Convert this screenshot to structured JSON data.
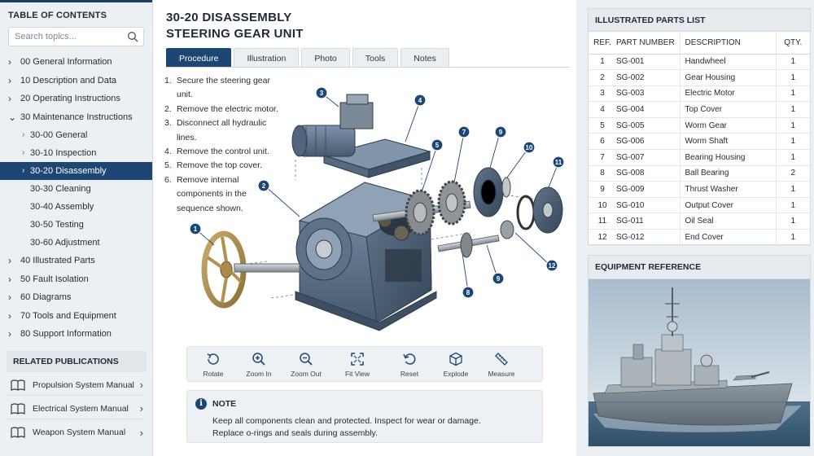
{
  "sidebar": {
    "toc_title": "TABLE OF CONTENTS",
    "search_placeholder": "Search topics...",
    "items": [
      {
        "label": "00 General Information",
        "chevron": "›"
      },
      {
        "label": "10 Description and Data",
        "chevron": "›"
      },
      {
        "label": "20 Operating Instructions",
        "chevron": "›"
      },
      {
        "label": "30 Maintenance Instructions",
        "chevron": "⌄"
      },
      {
        "label": "30-00   General",
        "chevron": "›"
      },
      {
        "label": "30-10   Inspection",
        "chevron": "›"
      },
      {
        "label": "30-20   Disassembly",
        "chevron": "›"
      },
      {
        "label": "30-30   Cleaning",
        "chevron": ""
      },
      {
        "label": "30-40   Assembly",
        "chevron": ""
      },
      {
        "label": "30-50   Testing",
        "chevron": ""
      },
      {
        "label": "30-60   Adjustment",
        "chevron": ""
      },
      {
        "label": "40 Illustrated Parts",
        "chevron": "›"
      },
      {
        "label": "50 Fault Isolation",
        "chevron": "›"
      },
      {
        "label": "60 Diagrams",
        "chevron": "›"
      },
      {
        "label": "70 Tools and Equipment",
        "chevron": "›"
      },
      {
        "label": "80 Support Information",
        "chevron": "›"
      }
    ],
    "related_title": "RELATED PUBLICATIONS",
    "publications": [
      {
        "label": "Propulsion System Manual",
        "chevron": "›"
      },
      {
        "label": "Electrical System Manual",
        "chevron": "›"
      },
      {
        "label": "Weapon System Manual",
        "chevron": "›"
      }
    ]
  },
  "main": {
    "title_line1": "30-20 DISASSEMBLY",
    "title_line2": "STEERING GEAR UNIT",
    "tabs": [
      "Procedure",
      "Illustration",
      "Photo",
      "Tools",
      "Notes"
    ],
    "steps": [
      {
        "num": "1.",
        "text": "Secure the steering gear unit."
      },
      {
        "num": "2.",
        "text": "Remove the electric motor."
      },
      {
        "num": "3.",
        "text": "Disconnect all hydraulic lines."
      },
      {
        "num": "4.",
        "text": "Remove the control unit."
      },
      {
        "num": "5.",
        "text": "Remove the top cover."
      },
      {
        "num": "6.",
        "text": "Remove internal components in the sequence shown."
      }
    ],
    "callouts": [
      "1",
      "2",
      "3",
      "4",
      "5",
      "7",
      "9",
      "10",
      "11",
      "12",
      "8",
      "9"
    ],
    "toolbar": [
      {
        "label": "Rotate",
        "icon": "rotate-icon"
      },
      {
        "label": "Zoom In",
        "icon": "zoom-in-icon"
      },
      {
        "label": "Zoom Out",
        "icon": "zoom-out-icon"
      },
      {
        "label": "Fit View",
        "icon": "fit-view-icon"
      },
      {
        "label": "Reset",
        "icon": "reset-icon"
      },
      {
        "label": "Explode",
        "icon": "cube-icon"
      },
      {
        "label": "Measure",
        "icon": "ruler-icon"
      }
    ],
    "note_icon": "i",
    "note_title": "NOTE",
    "note_text": "Keep all components clean and protected. Inspect for wear or damage. Replace o-rings and seals during assembly."
  },
  "parts_list": {
    "title": "ILLUSTRATED PARTS LIST",
    "headers": {
      "ref": "REF.",
      "part": "PART NUMBER",
      "desc": "DESCRIPTION",
      "qty": "QTY."
    },
    "rows": [
      {
        "ref": "1",
        "part": "SG-001",
        "desc": "Handwheel",
        "qty": "1"
      },
      {
        "ref": "2",
        "part": "SG-002",
        "desc": "Gear Housing",
        "qty": "1"
      },
      {
        "ref": "3",
        "part": "SG-003",
        "desc": "Electric Motor",
        "qty": "1"
      },
      {
        "ref": "4",
        "part": "SG-004",
        "desc": "Top Cover",
        "qty": "1"
      },
      {
        "ref": "5",
        "part": "SG-005",
        "desc": "Worm Gear",
        "qty": "1"
      },
      {
        "ref": "6",
        "part": "SG-006",
        "desc": "Worm Shaft",
        "qty": "1"
      },
      {
        "ref": "7",
        "part": "SG-007",
        "desc": "Bearing Housing",
        "qty": "1"
      },
      {
        "ref": "8",
        "part": "SG-008",
        "desc": "Ball Bearing",
        "qty": "2"
      },
      {
        "ref": "9",
        "part": "SG-009",
        "desc": "Thrust Washer",
        "qty": "1"
      },
      {
        "ref": "10",
        "part": "SG-010",
        "desc": "Output Cover",
        "qty": "1"
      },
      {
        "ref": "11",
        "part": "SG-011",
        "desc": "Oil Seal",
        "qty": "1"
      },
      {
        "ref": "12",
        "part": "SG-012",
        "desc": "End Cover",
        "qty": "1"
      }
    ]
  },
  "equipment": {
    "title": "EQUIPMENT REFERENCE"
  },
  "colors": {
    "accent": "#1d4675",
    "callout": "#1d4675",
    "panel": "#edf0f3"
  }
}
